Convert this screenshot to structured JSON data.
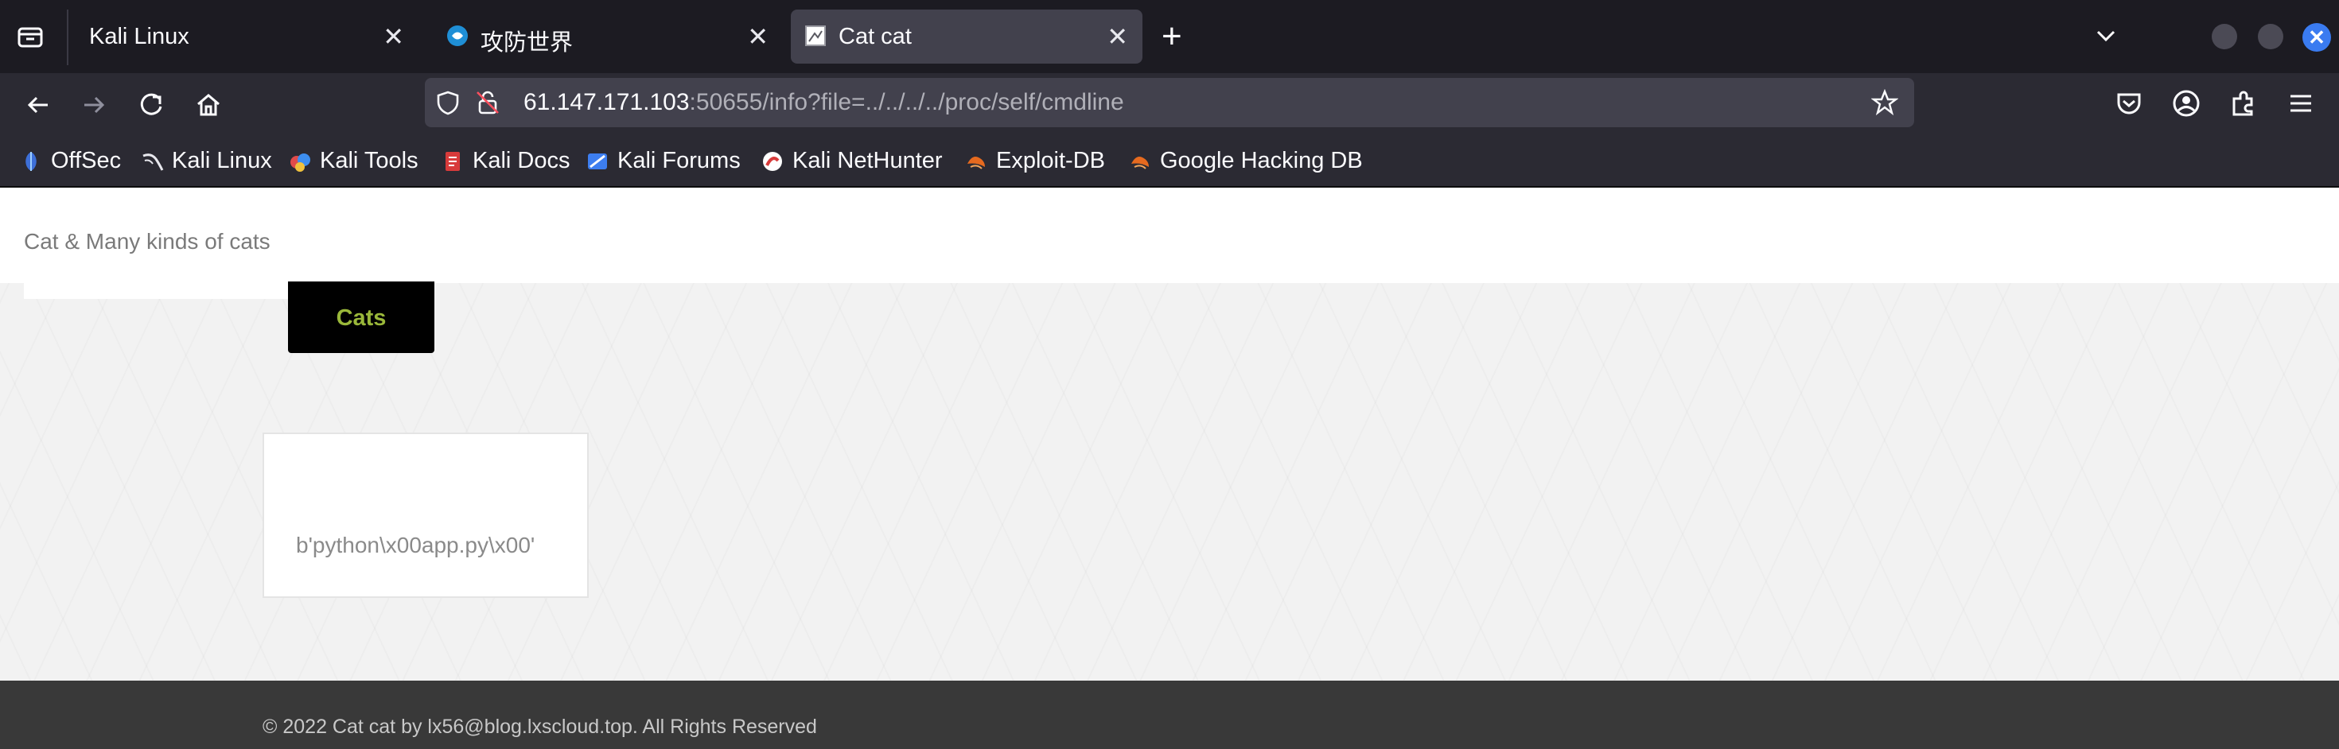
{
  "browser": {
    "tabs": [
      {
        "title": "Kali Linux",
        "active": false
      },
      {
        "title": "攻防世界",
        "active": false
      },
      {
        "title": "Cat cat",
        "active": true
      }
    ],
    "url": {
      "host": "61.147.171.103",
      "rest": ":50655/info?file=../../../../proc/self/cmdline"
    },
    "bookmarks": [
      {
        "label": "OffSec",
        "icon": "offsec-icon"
      },
      {
        "label": "Kali Linux",
        "icon": "kali-dragon-icon"
      },
      {
        "label": "Kali Tools",
        "icon": "kali-tools-icon"
      },
      {
        "label": "Kali Docs",
        "icon": "kali-docs-icon"
      },
      {
        "label": "Kali Forums",
        "icon": "kali-forums-icon"
      },
      {
        "label": "Kali NetHunter",
        "icon": "kali-nethunter-icon"
      },
      {
        "label": "Exploit-DB",
        "icon": "exploit-db-icon"
      },
      {
        "label": "Google Hacking DB",
        "icon": "ghdb-icon"
      }
    ],
    "colors": {
      "chrome_dark": "#1c1b22",
      "toolbar": "#2b2a33",
      "active_tab": "#42414d",
      "close_button": "#3a7bf0"
    }
  },
  "site": {
    "title": "Cat & Many kinds of cats",
    "nav_label": "Cats",
    "result": "b'python\\x00app.py\\x00'",
    "footer": "© 2022 Cat cat by lx56@blog.lxscloud.top. All Rights Reserved",
    "colors": {
      "nav_bg": "#000000",
      "nav_text": "#9ab83a",
      "footer_bg": "#393939"
    }
  }
}
